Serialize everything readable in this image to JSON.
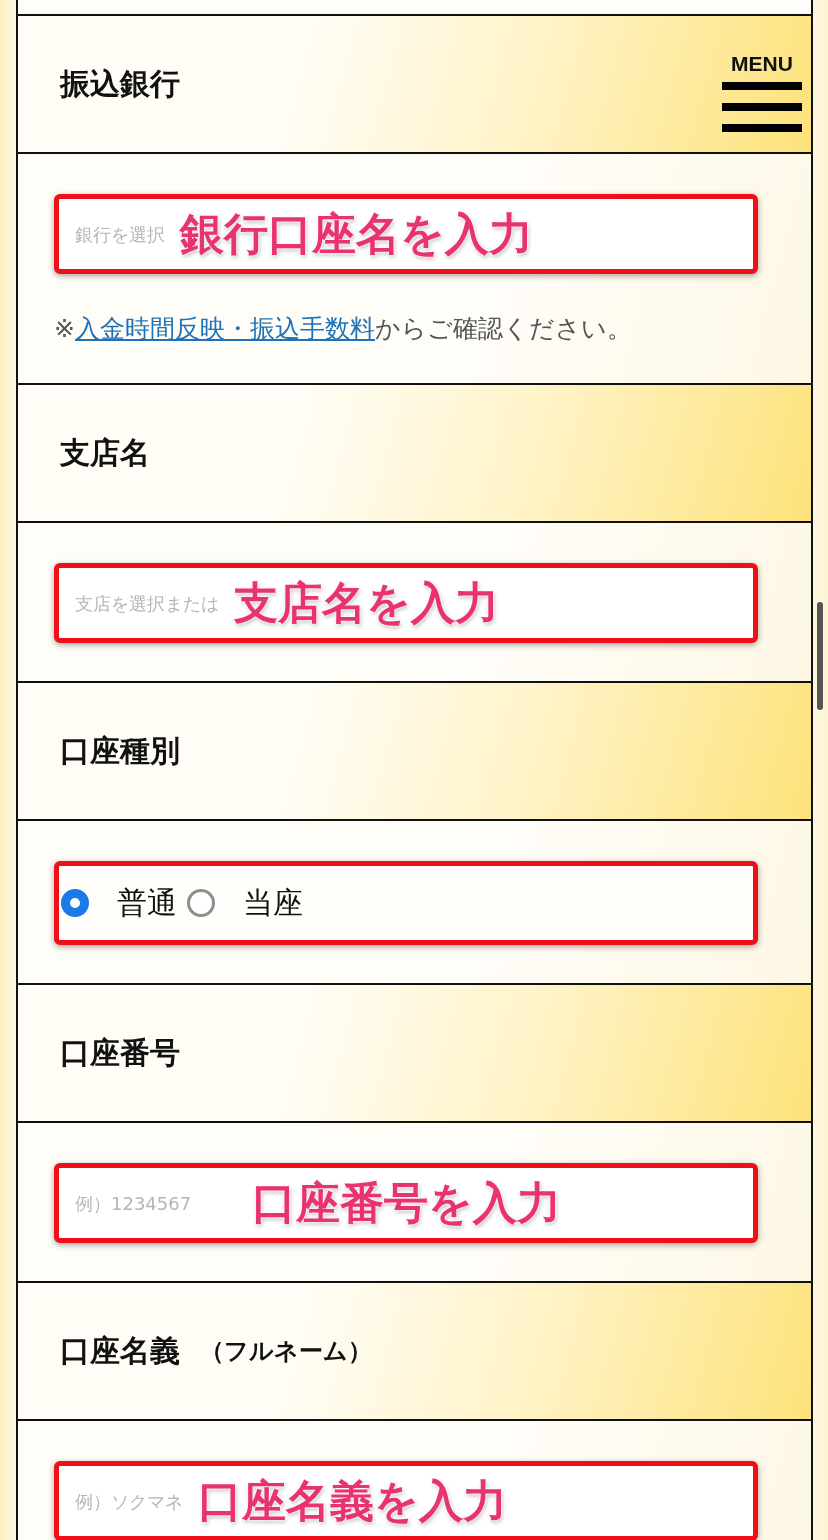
{
  "menu": {
    "label": "MENU"
  },
  "sections": [
    {
      "heading": "振込銀行",
      "kind": "text",
      "placeholder": "銀行を選択",
      "annotation": "銀行口座名を入力",
      "note": {
        "prefix": "※",
        "link": "入金時間反映・振込手数料",
        "suffix": "からご確認ください。"
      }
    },
    {
      "heading": "支店名",
      "kind": "text",
      "placeholder": "支店を選択または",
      "annotation": "支店名を入力"
    },
    {
      "heading": "口座種別",
      "kind": "radio",
      "options": [
        {
          "label": "普通",
          "selected": true
        },
        {
          "label": "当座",
          "selected": false
        }
      ]
    },
    {
      "heading": "口座番号",
      "kind": "text",
      "placeholder": "例）1234567",
      "annotation": "口座番号を入力"
    },
    {
      "heading": "口座名義",
      "heading_suffix": "（フルネーム）",
      "kind": "text",
      "placeholder": "例）ソクマネ",
      "annotation": "口座名義を入力"
    }
  ]
}
